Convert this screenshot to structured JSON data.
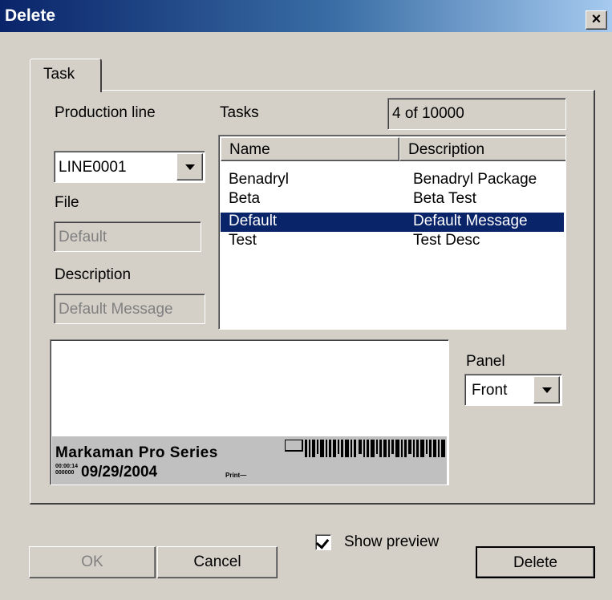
{
  "dialog": {
    "title": "Delete",
    "close_glyph": "×"
  },
  "tabs": [
    {
      "label": "Task"
    }
  ],
  "production_line": {
    "label": "Production line",
    "value": "LINE0001"
  },
  "file": {
    "label": "File",
    "value": "Default"
  },
  "description": {
    "label": "Description",
    "value": "Default Message"
  },
  "tasks": {
    "label": "Tasks",
    "count": "4 of 10000",
    "columns": [
      "Name",
      "Description"
    ],
    "rows": [
      {
        "name": "Benadryl",
        "description": "Benadryl Package",
        "selected": false
      },
      {
        "name": "Beta",
        "description": "Beta Test",
        "selected": false
      },
      {
        "name": "Default",
        "description": "Default Message",
        "selected": true
      },
      {
        "name": "Test",
        "description": "Test Desc",
        "selected": false
      }
    ]
  },
  "preview": {
    "line1": "Markaman Pro Series",
    "small1": "00:00:14",
    "small2": "000000",
    "date": "09/29/2004",
    "tiny": "Print—"
  },
  "panel": {
    "label": "Panel",
    "value": "Front"
  },
  "show_preview": {
    "label": "Show preview",
    "checked": true
  },
  "buttons": {
    "ok": "OK",
    "cancel": "Cancel",
    "delete": "Delete"
  }
}
